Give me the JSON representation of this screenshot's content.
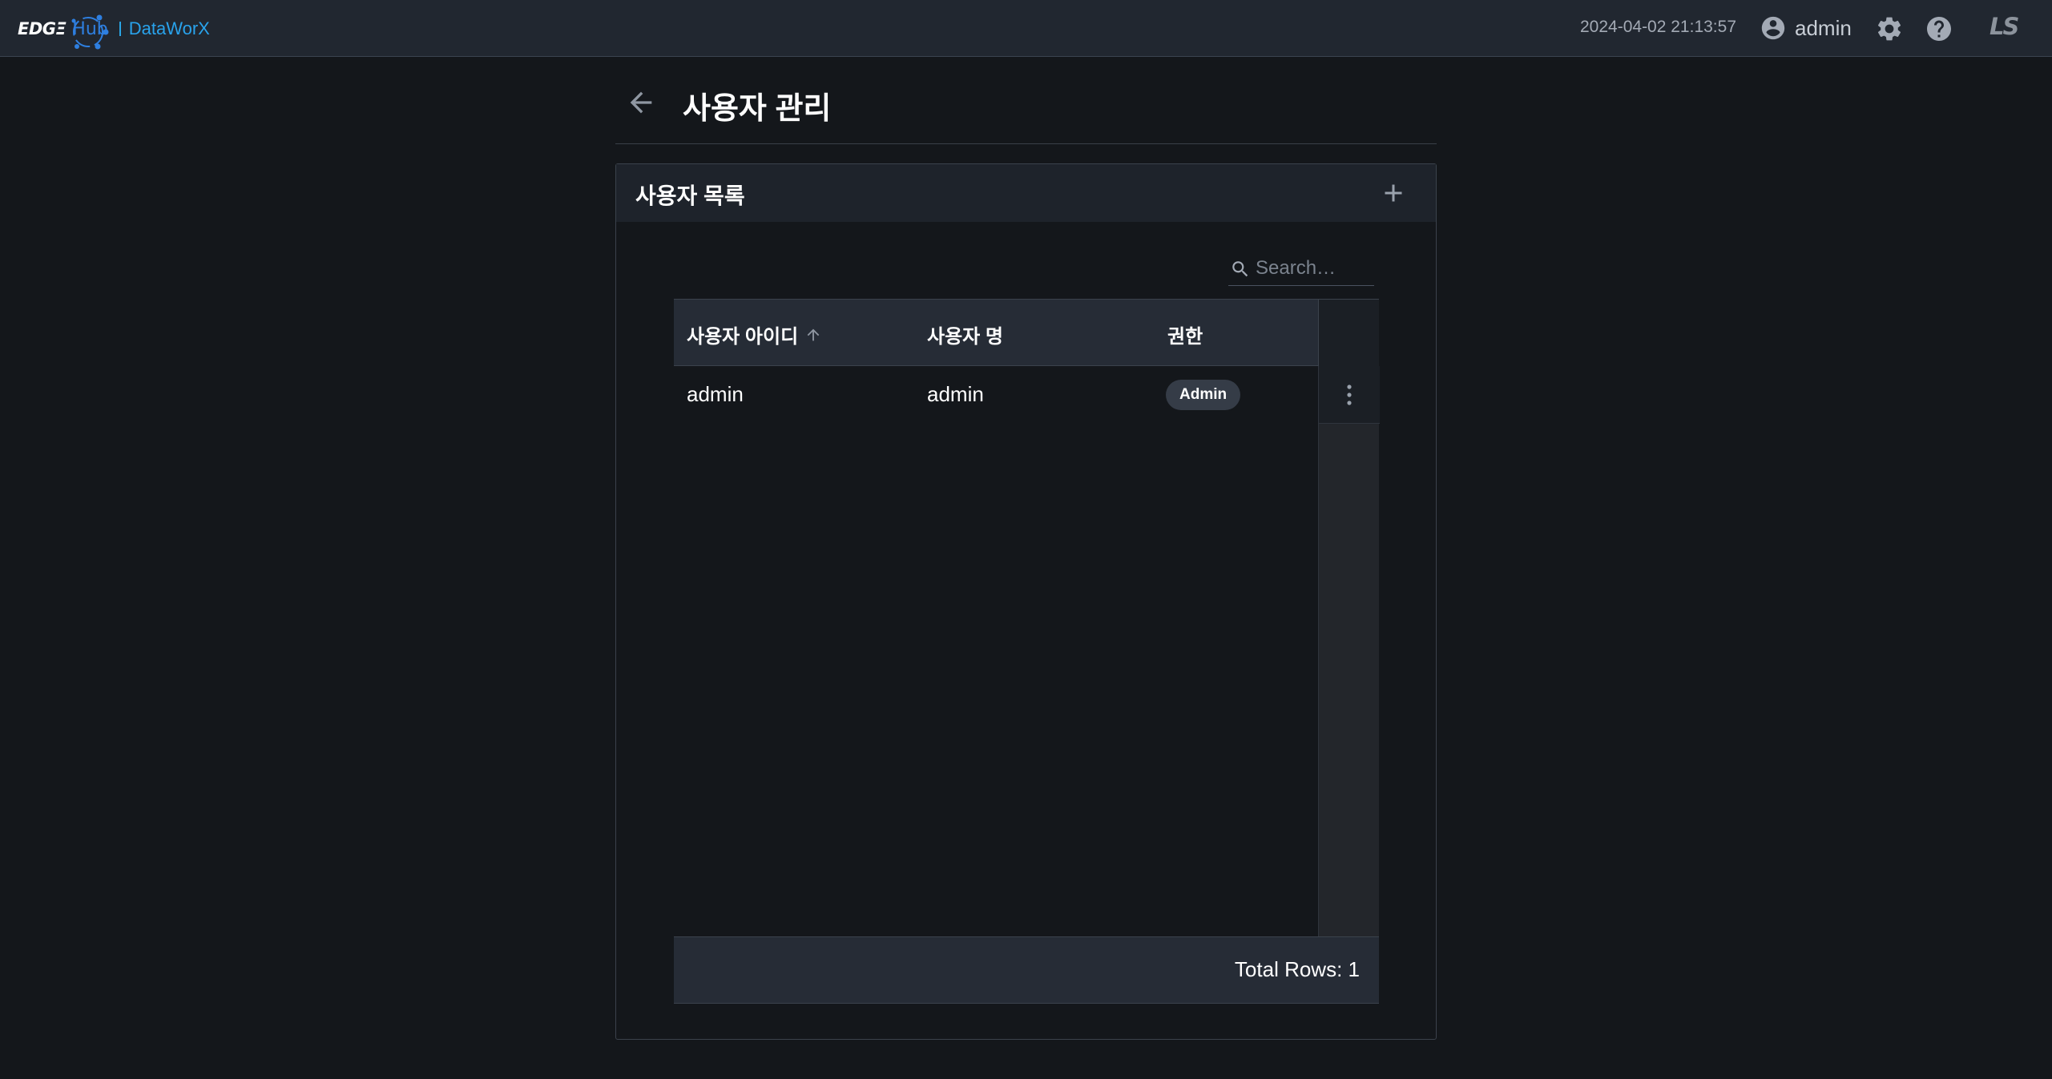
{
  "app": {
    "brand_edge": "EDGΞ",
    "brand_hub": "Hub",
    "brand_product": "DataWorX",
    "timestamp": "2024-04-02 21:13:57",
    "user_name": "admin",
    "corp_logo": "LS"
  },
  "page": {
    "title": "사용자 관리"
  },
  "card": {
    "title": "사용자 목록"
  },
  "search": {
    "placeholder": "Search…",
    "value": ""
  },
  "table": {
    "columns": [
      "사용자 아이디",
      "사용자 명",
      "권한"
    ],
    "sort": {
      "column": "사용자 아이디",
      "direction": "asc"
    },
    "rows": [
      {
        "user_id": "admin",
        "user_name": "admin",
        "role": "Admin"
      }
    ],
    "total_label": "Total Rows: 1"
  },
  "icons": {
    "back": "arrow-left-icon",
    "account": "account-circle-icon",
    "settings": "gear-icon",
    "help": "help-icon",
    "add": "plus-icon",
    "search": "search-icon",
    "sort": "arrow-up-icon",
    "row_menu": "more-vertical-icon"
  },
  "colors": {
    "background": "#14171b",
    "topbar": "#212730",
    "brand_blue": "#2e7fe0",
    "product_blue": "#29a3ec",
    "table_header": "#262c36"
  }
}
